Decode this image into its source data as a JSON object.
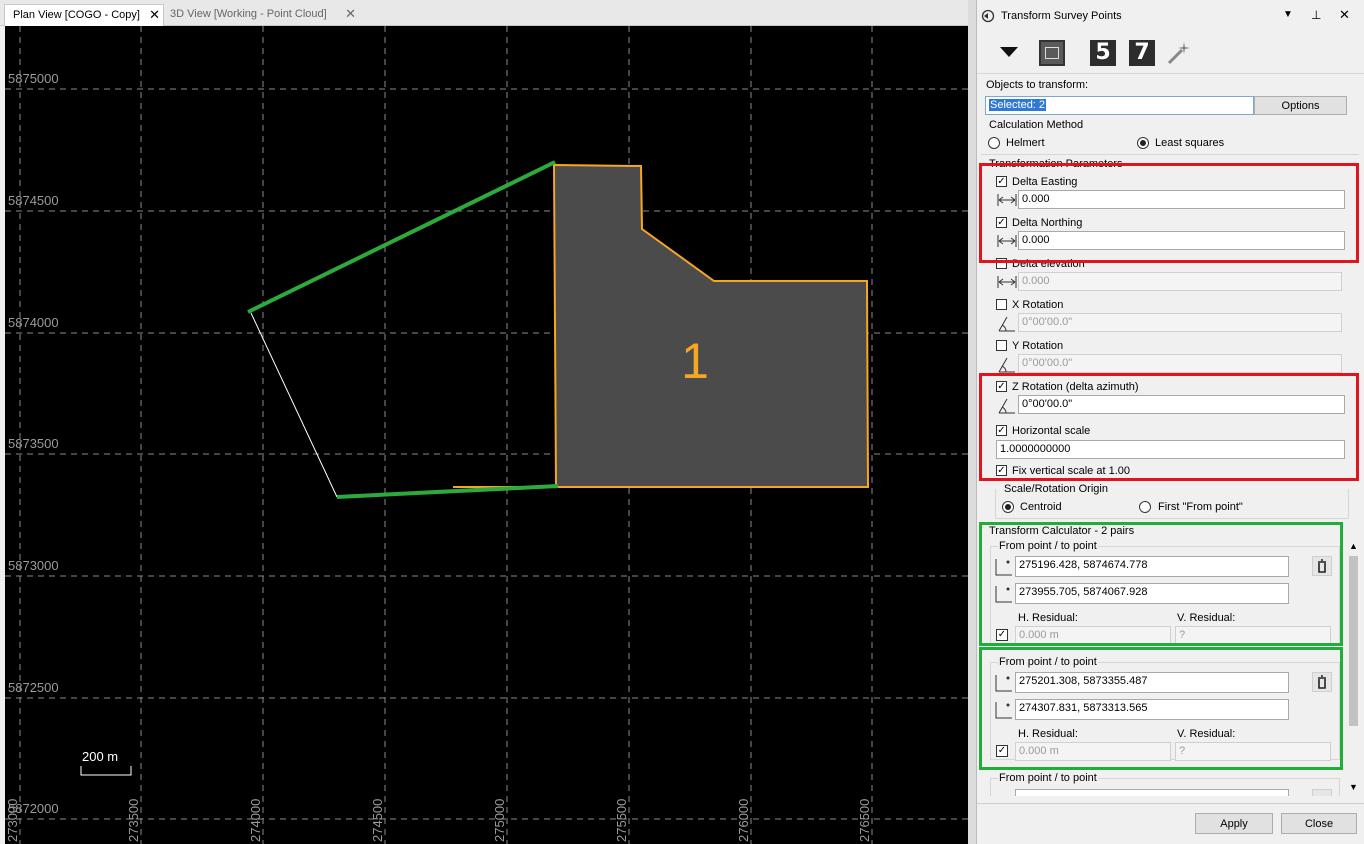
{
  "tabs": [
    {
      "label": "Plan View [COGO - Copy]",
      "close": "✕"
    },
    {
      "label": "3D View [Working - Point Cloud]",
      "close": "✕"
    }
  ],
  "plan": {
    "y_ticks": [
      "5875000",
      "5874500",
      "5874000",
      "5873500",
      "5873000",
      "5872500",
      "5872000"
    ],
    "x_ticks": [
      "273000",
      "273500",
      "274000",
      "274500",
      "275000",
      "275500",
      "276000",
      "276500"
    ],
    "polygon_label": "1",
    "scale_bar": "200 m"
  },
  "panel": {
    "title": "Transform Survey Points",
    "objects_label": "Objects to transform:",
    "objects_value": "Selected: 2",
    "options_button": "Options",
    "calc_method": {
      "title": "Calculation Method",
      "options": [
        "Helmert",
        "Least squares"
      ],
      "selected": "Least squares"
    },
    "params_title": "Transformation Parameters",
    "delta_easting": {
      "label": "Delta Easting",
      "value": "0.000",
      "checked": true
    },
    "delta_northing": {
      "label": "Delta Northing",
      "value": "0.000",
      "checked": true
    },
    "delta_elevation": {
      "label": "Delta elevation",
      "value": "0.000",
      "checked": false
    },
    "x_rotation": {
      "label": "X Rotation",
      "value": "0°00'00.0\"",
      "checked": false
    },
    "y_rotation": {
      "label": "Y Rotation",
      "value": "0°00'00.0\"",
      "checked": false
    },
    "z_rotation": {
      "label": "Z Rotation (delta azimuth)",
      "value": "0°00'00.0\"",
      "checked": true
    },
    "horizontal_scale": {
      "label": "Horizontal scale",
      "value": "1.0000000000",
      "checked": true
    },
    "fix_vertical": {
      "label": "Fix vertical scale at 1.00",
      "checked": true
    },
    "origin": {
      "title": "Scale/Rotation Origin",
      "options": [
        "Centroid",
        "First \"From point\""
      ],
      "selected": "Centroid"
    },
    "calculator": {
      "title": "Transform Calculator - 2 pairs",
      "pairs": [
        {
          "header": "From point / to point",
          "from": "275196.428, 5874674.778",
          "to": "273955.705, 5874067.928",
          "h_label": "H. Residual:",
          "v_label": "V. Residual:",
          "h_value": "0.000 m",
          "v_value": "?"
        },
        {
          "header": "From point / to point",
          "from": "275201.308, 5873355.487",
          "to": "274307.831, 5873313.565",
          "h_label": "H. Residual:",
          "v_label": "V. Residual:",
          "h_value": "0.000 m",
          "v_value": "?"
        },
        {
          "header": "From point / to point"
        }
      ]
    },
    "apply_button": "Apply",
    "close_button": "Close"
  },
  "colors": {
    "highlight_red": "#e0141e",
    "highlight_green": "#1fae3a",
    "polygon_outline": "#f5a623",
    "polygon_fill": "#4b4b4b",
    "vector_green": "#2eaa3c"
  }
}
